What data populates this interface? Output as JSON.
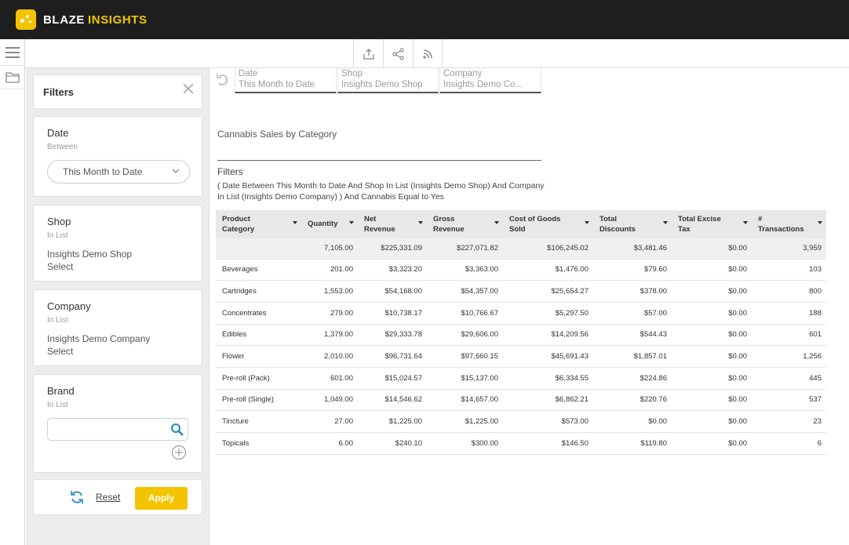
{
  "app": {
    "brand_main": "BLAZE",
    "brand_accent": "INSIGHTS",
    "accent_color": "#f5c400"
  },
  "toolbar": {
    "icons": [
      "upload-icon",
      "share-icon",
      "rss-icon"
    ]
  },
  "filter_chips": [
    {
      "label": "Date",
      "value": "This Month to Date"
    },
    {
      "label": "Shop",
      "value": "Insights Demo Shop"
    },
    {
      "label": "Company",
      "value": "Insights Demo Co..."
    }
  ],
  "filters_panel": {
    "title": "Filters",
    "date": {
      "title": "Date",
      "operator": "Between",
      "selected": "This Month to Date"
    },
    "shop": {
      "title": "Shop",
      "operator": "In List",
      "value": "Insights Demo Shop",
      "select_label": "Select"
    },
    "company": {
      "title": "Company",
      "operator": "In List",
      "value": "Insights Demo Company",
      "select_label": "Select"
    },
    "brand": {
      "title": "Brand",
      "operator": "In List",
      "search_value": ""
    },
    "reset_label": "Reset",
    "apply_label": "Apply"
  },
  "report": {
    "title": "Cannabis Sales by Category",
    "filters_label": "Filters",
    "filters_description": "( Date Between This Month to Date And Shop In List (Insights Demo Shop) And Company In List (Insights Demo Company) ) And Cannabis Equal to Yes",
    "columns": [
      "Product Category",
      "Quantity",
      "Net Revenue",
      "Gross Revenue",
      "Cost of Goods Sold",
      "Total Discounts",
      "Total Excise Tax",
      "# Transactions"
    ],
    "totals": [
      "",
      "7,105.00",
      "$225,331.09",
      "$227,071.82",
      "$106,245.02",
      "$3,481.46",
      "$0.00",
      "3,959"
    ],
    "rows": [
      [
        "Beverages",
        "201.00",
        "$3,323.20",
        "$3,363.00",
        "$1,476.00",
        "$79.60",
        "$0.00",
        "103"
      ],
      [
        "Cartridges",
        "1,553.00",
        "$54,168.00",
        "$54,357.00",
        "$25,654.27",
        "$378.00",
        "$0.00",
        "800"
      ],
      [
        "Concentrates",
        "279.00",
        "$10,738.17",
        "$10,766.67",
        "$5,297.50",
        "$57.00",
        "$0.00",
        "188"
      ],
      [
        "Edibles",
        "1,379.00",
        "$29,333.78",
        "$29,606.00",
        "$14,209.56",
        "$544.43",
        "$0.00",
        "601"
      ],
      [
        "Flower",
        "2,010.00",
        "$96,731.64",
        "$97,660.15",
        "$45,691.43",
        "$1,857.01",
        "$0.00",
        "1,256"
      ],
      [
        "Pre-roll (Pack)",
        "601.00",
        "$15,024.57",
        "$15,137.00",
        "$6,334.55",
        "$224.86",
        "$0.00",
        "445"
      ],
      [
        "Pre-roll (Single)",
        "1,049.00",
        "$14,546.62",
        "$14,657.00",
        "$6,862.21",
        "$220.76",
        "$0.00",
        "537"
      ],
      [
        "Tincture",
        "27.00",
        "$1,225.00",
        "$1,225.00",
        "$573.00",
        "$0.00",
        "$0.00",
        "23"
      ],
      [
        "Topicals",
        "6.00",
        "$240.10",
        "$300.00",
        "$146.50",
        "$119.80",
        "$0.00",
        "6"
      ]
    ]
  }
}
